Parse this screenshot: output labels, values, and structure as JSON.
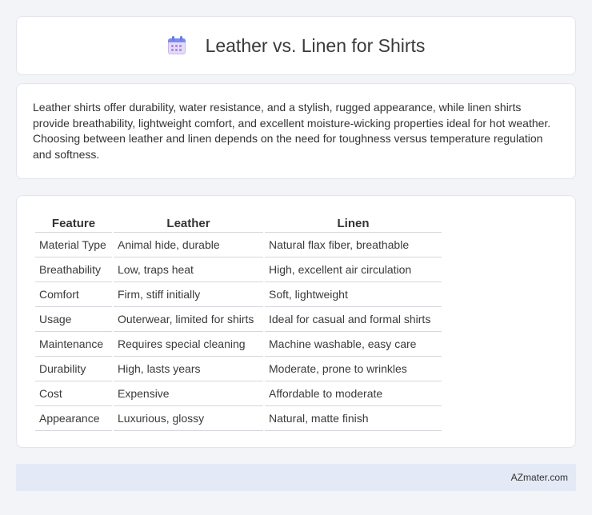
{
  "header": {
    "title": "Leather vs. Linen for Shirts",
    "icon": "calendar-icon"
  },
  "description": "Leather shirts offer durability, water resistance, and a stylish, rugged appearance, while linen shirts provide breathability, lightweight comfort, and excellent moisture-wicking properties ideal for hot weather. Choosing between leather and linen depends on the need for toughness versus temperature regulation and softness.",
  "table": {
    "headers": [
      "Feature",
      "Leather",
      "Linen"
    ],
    "rows": [
      [
        "Material Type",
        "Animal hide, durable",
        "Natural flax fiber, breathable"
      ],
      [
        "Breathability",
        "Low, traps heat",
        "High, excellent air circulation"
      ],
      [
        "Comfort",
        "Firm, stiff initially",
        "Soft, lightweight"
      ],
      [
        "Usage",
        "Outerwear, limited for shirts",
        "Ideal for casual and formal shirts"
      ],
      [
        "Maintenance",
        "Requires special cleaning",
        "Machine washable, easy care"
      ],
      [
        "Durability",
        "High, lasts years",
        "Moderate, prone to wrinkles"
      ],
      [
        "Cost",
        "Expensive",
        "Affordable to moderate"
      ],
      [
        "Appearance",
        "Luxurious, glossy",
        "Natural, matte finish"
      ]
    ]
  },
  "footer": {
    "site": "AZmater.com"
  }
}
